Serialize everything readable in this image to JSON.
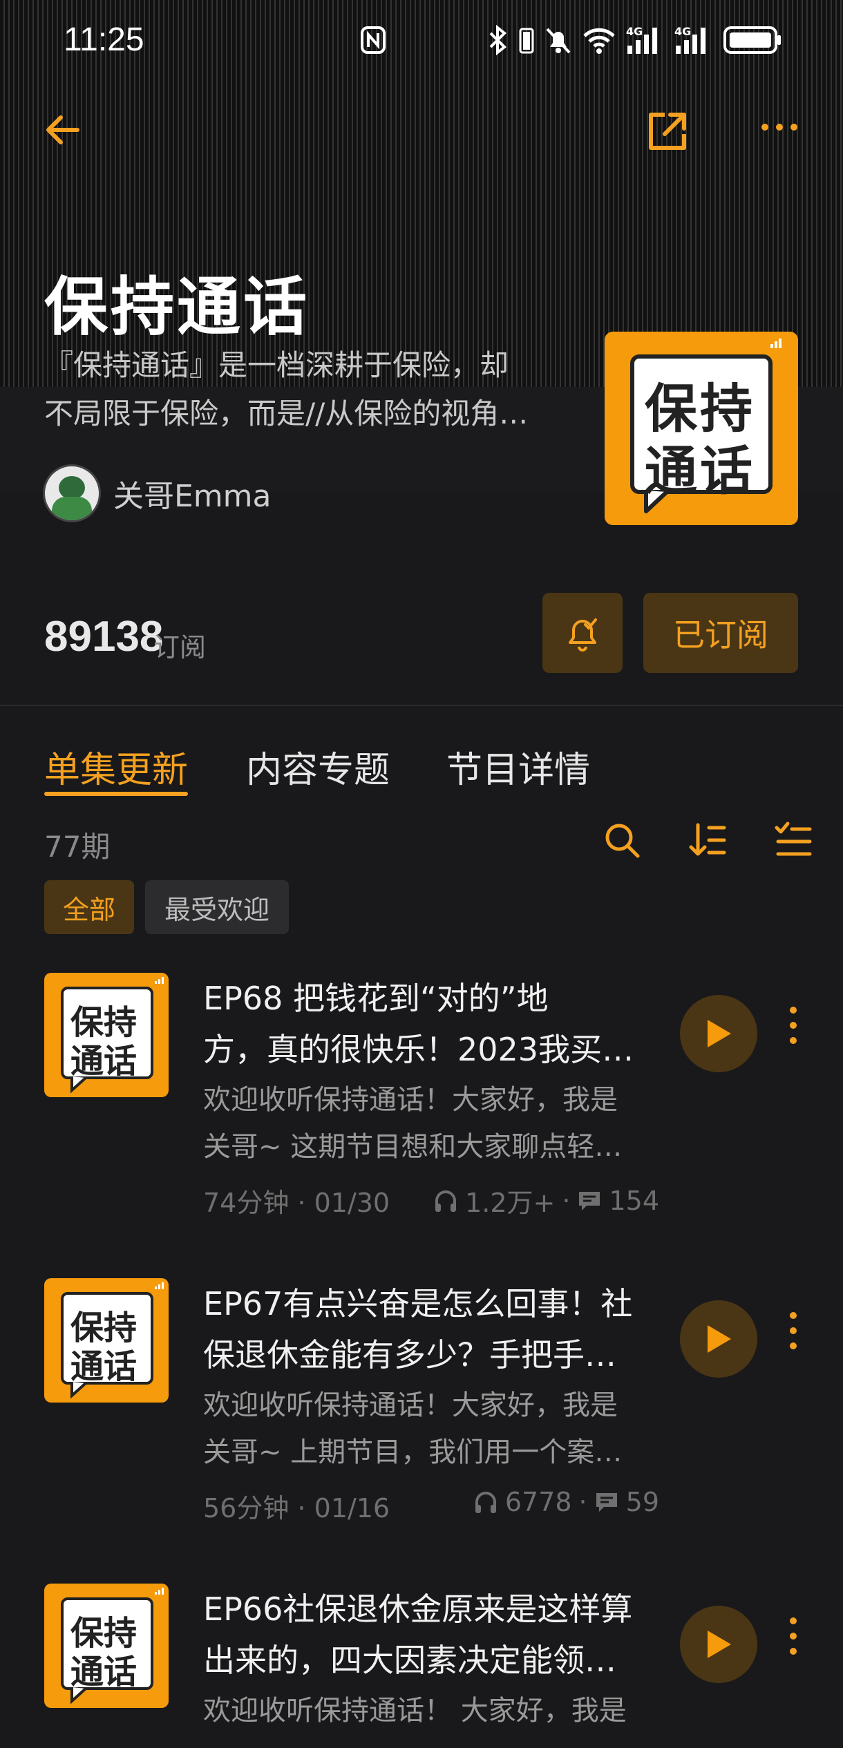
{
  "status_bar": {
    "time": "11:25",
    "network_1": "4G",
    "network_2": "4G"
  },
  "show": {
    "title": "保持通话",
    "description_line1": "『保持通话』是一档深耕于保险，却",
    "description_line2": "不局限于保险，而是//从保险的视角…",
    "author": "关哥Emma",
    "cover_text_line1": "保持",
    "cover_text_line2": "通话"
  },
  "stats": {
    "subscribers": "89138",
    "subscribers_label": "订阅",
    "subscribed_label": "已订阅"
  },
  "tabs": [
    {
      "label": "单集更新"
    },
    {
      "label": "内容专题"
    },
    {
      "label": "节目详情"
    }
  ],
  "list": {
    "episode_count": "77期"
  },
  "filters": {
    "all": "全部",
    "popular": "最受欢迎"
  },
  "episodes": [
    {
      "title_line1": "EP68 把钱花到“对的”地",
      "title_line2": "方，真的很快乐！2023我买…",
      "desc_line1": "欢迎收听保持通话！大家好，我是",
      "desc_line2": "关哥~ 这期节目想和大家聊点轻…",
      "duration_date": "74分钟 · 01/30",
      "plays": "1.2万+",
      "comments": "154"
    },
    {
      "title_line1": "EP67有点兴奋是怎么回事！社",
      "title_line2": "保退休金能有多少？手把手…",
      "desc_line1": "欢迎收听保持通话！大家好，我是",
      "desc_line2": "关哥~ 上期节目，我们用一个案…",
      "duration_date": "56分钟 · 01/16",
      "plays": "6778",
      "comments": "59"
    },
    {
      "title_line1": "EP66社保退休金原来是这样算",
      "title_line2": "出来的，四大因素决定能领…",
      "desc_line1": "欢迎收听保持通话！ 大家好，我是",
      "desc_line2": "",
      "duration_date": "",
      "plays": "",
      "comments": ""
    }
  ],
  "colors": {
    "accent": "#f4a020",
    "cover_orange": "#f59b0c",
    "background": "#19191b",
    "button_bg": "#4a3615"
  }
}
